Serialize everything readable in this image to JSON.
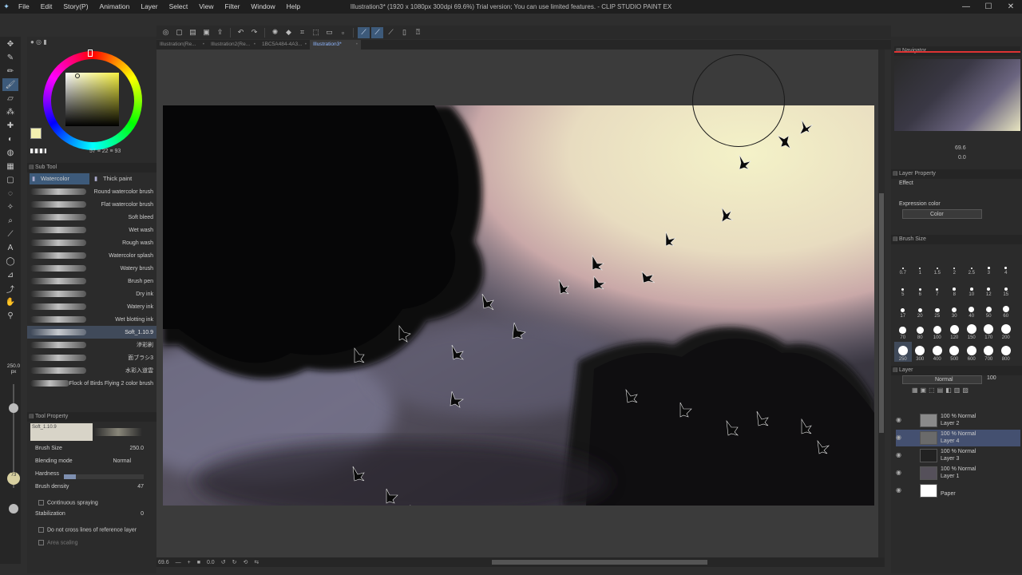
{
  "window": {
    "title": "Illustration3* (1920 x 1080px 300dpi 69.6%)  Trial version; You can use limited features. - CLIP STUDIO PAINT EX",
    "minimize": "—",
    "maximize": "☐",
    "close": "✕"
  },
  "menu": [
    "File",
    "Edit",
    "Story(P)",
    "Animation",
    "Layer",
    "Select",
    "View",
    "Filter",
    "Window",
    "Help"
  ],
  "tabs": [
    {
      "label": "Illustration(Re...",
      "active": false
    },
    {
      "label": "Illustration2(Re...",
      "active": false
    },
    {
      "label": "1BC5A484-4A3...",
      "active": false
    },
    {
      "label": "Illustration3*",
      "active": true
    }
  ],
  "color": {
    "main": "#f4f0b0",
    "sub": "#ffffff",
    "values": "57 ≡ 22 ≡ 93"
  },
  "subtool": {
    "header": "Sub Tool",
    "tabs": [
      {
        "label": "Watercolor",
        "active": true
      },
      {
        "label": "Thick paint",
        "active": false
      }
    ],
    "brushes": [
      {
        "name": "Round watercolor brush",
        "selected": false
      },
      {
        "name": "Flat watercolor brush",
        "selected": false
      },
      {
        "name": "Soft bleed",
        "selected": false
      },
      {
        "name": "Wet wash",
        "selected": false
      },
      {
        "name": "Rough wash",
        "selected": false
      },
      {
        "name": "Watercolor splash",
        "selected": false
      },
      {
        "name": "Watery brush",
        "selected": false
      },
      {
        "name": "Brush pen",
        "selected": false
      },
      {
        "name": "Dry ink",
        "selected": false
      },
      {
        "name": "Watery ink",
        "selected": false
      },
      {
        "name": "Wet blotting ink",
        "selected": false
      },
      {
        "name": "Soft_1.10.9",
        "selected": true
      },
      {
        "name": "滲彩刷",
        "selected": false
      },
      {
        "name": "面ブラシ3",
        "selected": false
      },
      {
        "name": "水彩入道雲",
        "selected": false
      },
      {
        "name": "Flock of Birds Flying 2 color brush",
        "selected": false
      }
    ]
  },
  "toolprop": {
    "header": "Tool Property",
    "preview_name": "Soft_1.10.9",
    "brush_size_label": "Brush Size",
    "brush_size_value": "250.0",
    "blending_label": "Blending mode",
    "blending_value": "Normal",
    "hardness_label": "Hardness",
    "hardness_level": 0.15,
    "density_label": "Brush density",
    "density_value": "47",
    "density_level": 0.47,
    "continuous_label": "Continuous spraying",
    "stabilization_label": "Stabilization",
    "stabilization_value": "0",
    "no_cross_label": "Do not cross lines of reference layer",
    "area_scaling_label": "Area scaling"
  },
  "sizebar": {
    "size": "250.0",
    "unit": "px",
    "opacity": "73"
  },
  "navigator": {
    "header": "Navigator",
    "zoom": "69.6",
    "angle": "0.0"
  },
  "layerprop": {
    "header": "Layer Property",
    "effect_label": "Effect",
    "expression_label": "Expression color",
    "expression_value": "Color"
  },
  "brushsize_panel": {
    "header": "Brush Size",
    "sizes": [
      "0.7",
      "1",
      "1.5",
      "2",
      "2.5",
      "3",
      "4",
      "5",
      "6",
      "7",
      "8",
      "10",
      "12",
      "15",
      "17",
      "20",
      "25",
      "30",
      "40",
      "50",
      "60",
      "70",
      "80",
      "100",
      "120",
      "150",
      "170",
      "200",
      "250",
      "300",
      "400",
      "500",
      "600",
      "700",
      "800"
    ],
    "selected": "250"
  },
  "layers": {
    "header": "Layer",
    "mode": "Normal",
    "opacity": "100",
    "items": [
      {
        "line1": "100 % Normal",
        "line2": "Layer 2",
        "selected": false,
        "thumb": "#8a8a8a"
      },
      {
        "line1": "100 % Normal",
        "line2": "Layer 4",
        "selected": true,
        "thumb": "#6a6a6a"
      },
      {
        "line1": "100 % Normal",
        "line2": "Layer 3",
        "selected": false,
        "thumb": "#222222"
      },
      {
        "line1": "100 % Normal",
        "line2": "Layer 1",
        "selected": false,
        "thumb": "#55505a"
      },
      {
        "line1": "",
        "line2": "Paper",
        "selected": false,
        "thumb": "#ffffff"
      }
    ]
  },
  "status": {
    "zoom": "69.6",
    "angle": "0.0"
  }
}
